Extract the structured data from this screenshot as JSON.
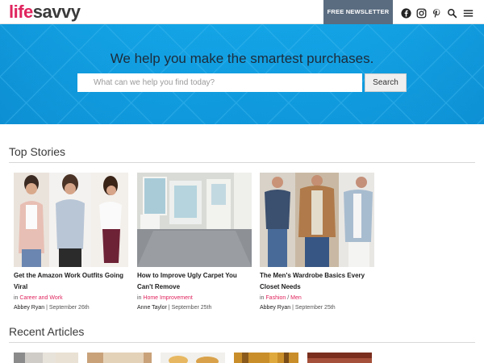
{
  "header": {
    "logo_part1": "life",
    "logo_part2": "savvy",
    "newsletter_label": "FREE NEWSLETTER",
    "icons": [
      "facebook-icon",
      "instagram-icon",
      "pinterest-icon",
      "search-icon",
      "menu-icon"
    ]
  },
  "hero": {
    "headline": "We help you make the smartest purchases.",
    "search_placeholder": "What can we help you find today?",
    "search_value": "",
    "search_button": "Search"
  },
  "top_stories": {
    "title": "Top Stories",
    "items": [
      {
        "title": "Get the Amazon Work Outfits Going Viral",
        "prefix": "in",
        "categories": [
          "Career and Work"
        ],
        "author": "Abbey Ryan",
        "date": "September 26th"
      },
      {
        "title": "How to Improve Ugly Carpet You Can't Remove",
        "prefix": "in",
        "categories": [
          "Home Improvement"
        ],
        "author": "Anne Taylor",
        "date": "September 25th"
      },
      {
        "title": "The Men's Wardrobe Basics Every Closet Needs",
        "prefix": "in",
        "categories": [
          "Fashion",
          "Men"
        ],
        "author": "Abbey Ryan",
        "date": "September 25th"
      }
    ]
  },
  "recent_articles": {
    "title": "Recent Articles"
  },
  "colors": {
    "brand_pink": "#e0245e",
    "hero_blue": "#13a4e6",
    "newsletter_bg": "#5a6c80"
  }
}
